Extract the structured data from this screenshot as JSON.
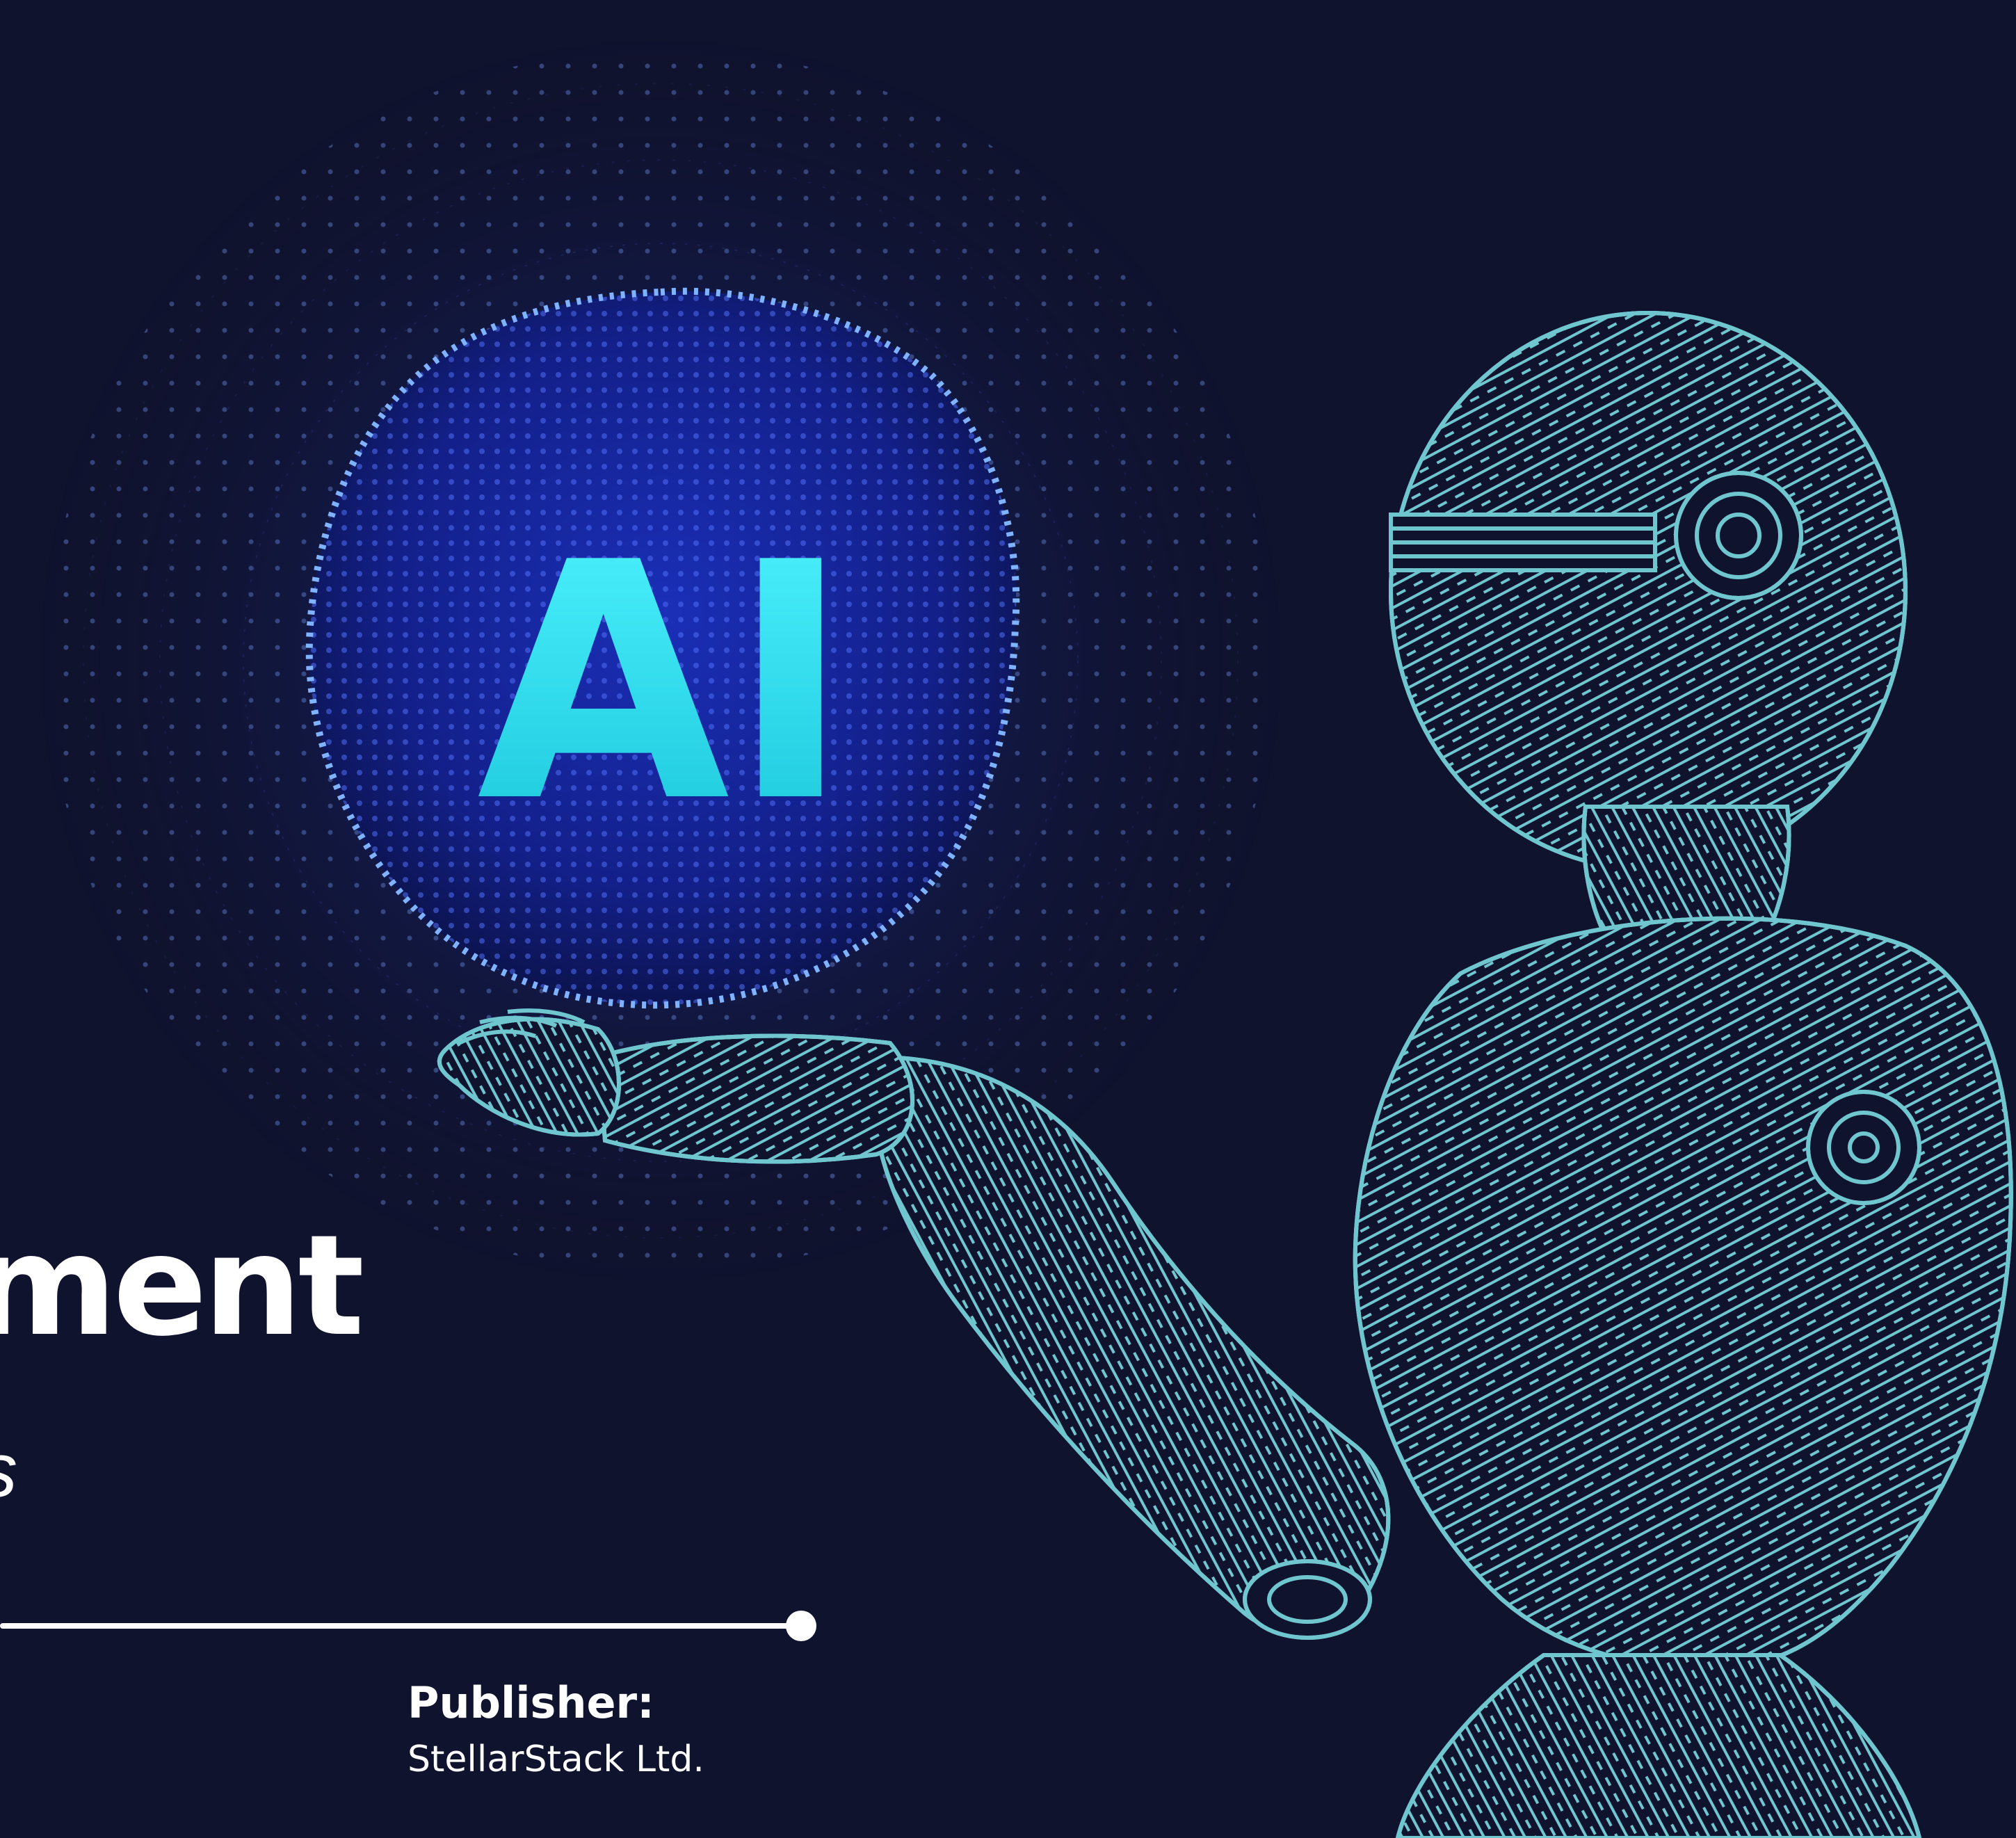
{
  "cover": {
    "title_fragment": "ment",
    "subtitle_fragment": "s",
    "sphere_text": "AI",
    "publisher_label": "Publisher:",
    "publisher_name": "StellarStack Ltd."
  },
  "colors": {
    "background": "#10132e",
    "text": "#ffffff",
    "robot_line": "#6fc6cf",
    "sphere_dots": "#3a56e8",
    "sphere_text": "#2ee6f0"
  },
  "illustration": {
    "sphere_icon": "ai-sphere-icon",
    "robot_icon": "wireframe-robot-icon"
  }
}
